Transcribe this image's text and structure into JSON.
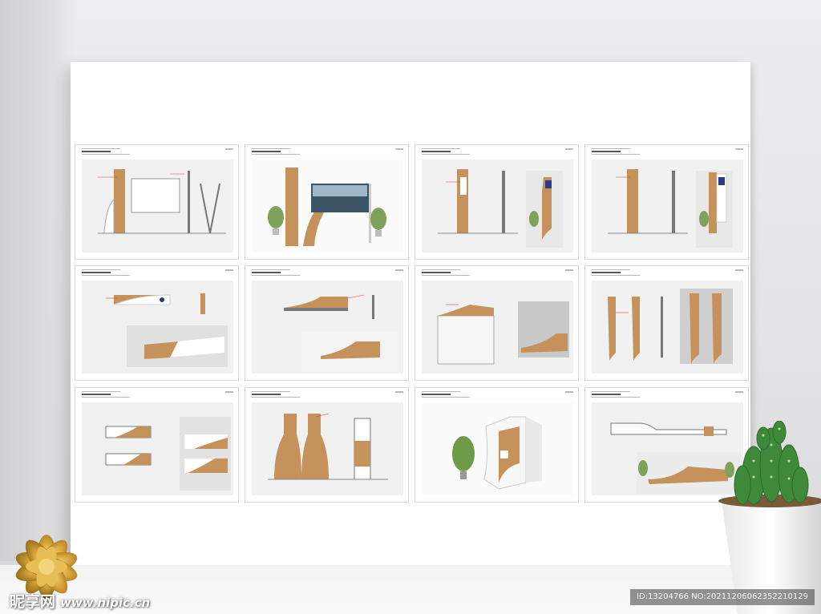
{
  "scene": {
    "wall_color": "#e9e9eb",
    "board_color": "#ffffff",
    "wood_color": "#c4925a",
    "annotation_color": "#d04040"
  },
  "panels": [
    {
      "row": 1,
      "col": 1,
      "kind": "elevation-frame-sign"
    },
    {
      "row": 1,
      "col": 2,
      "kind": "render-screen-sign"
    },
    {
      "row": 1,
      "col": 3,
      "kind": "elevation-parking-sign"
    },
    {
      "row": 1,
      "col": 4,
      "kind": "elevation-parking-sign-b"
    },
    {
      "row": 2,
      "col": 1,
      "kind": "elevation-hanging-sign"
    },
    {
      "row": 2,
      "col": 2,
      "kind": "elevation-wall-sign"
    },
    {
      "row": 2,
      "col": 3,
      "kind": "elevation-reception-desk"
    },
    {
      "row": 2,
      "col": 4,
      "kind": "elevation-restroom-sign"
    },
    {
      "row": 3,
      "col": 1,
      "kind": "elevation-door-plate"
    },
    {
      "row": 3,
      "col": 2,
      "kind": "elevation-bottle-pylon"
    },
    {
      "row": 3,
      "col": 3,
      "kind": "render-pylon"
    },
    {
      "row": 3,
      "col": 4,
      "kind": "elevation-bench"
    }
  ],
  "watermark": {
    "brand": "昵享网",
    "url": "www.nipic.cn"
  },
  "image_id": "ID:13204766 NO:20211206062352210129"
}
